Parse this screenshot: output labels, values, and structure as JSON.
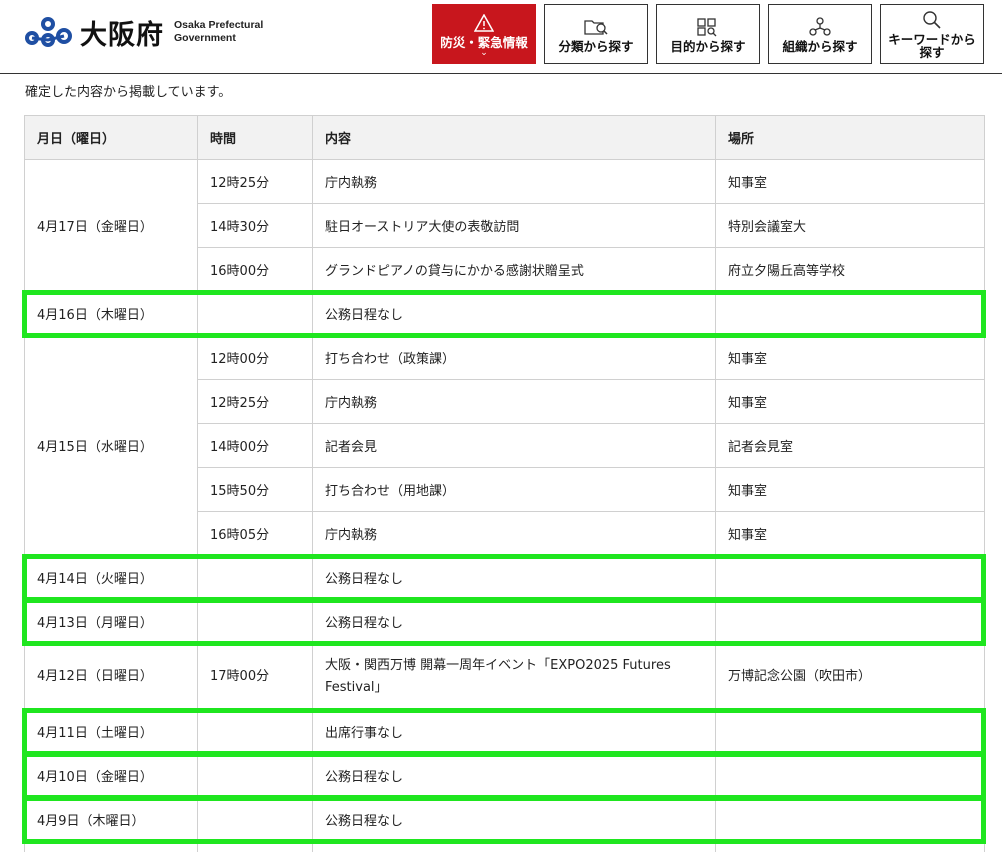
{
  "header": {
    "logo_jp": "大阪府",
    "logo_en_line1": "Osaka Prefectural",
    "logo_en_line2": "Government",
    "nav": [
      {
        "label": "防災・緊急情報",
        "icon": "warning-icon"
      },
      {
        "label": "分類から探す",
        "icon": "folder-search-icon"
      },
      {
        "label": "目的から探す",
        "icon": "grid-search-icon"
      },
      {
        "label": "組織から探す",
        "icon": "org-icon"
      },
      {
        "label": "キーワードから探す",
        "icon": "search-icon"
      }
    ],
    "emergency_color": "#c8161d"
  },
  "intro": "確定した内容から掲載しています。",
  "table": {
    "headers": [
      "月日（曜日）",
      "時間",
      "内容",
      "場所"
    ],
    "groups": [
      {
        "date": "4月17日（金曜日）",
        "rows": [
          {
            "time": "12時25分",
            "content": "庁内執務",
            "place": "知事室"
          },
          {
            "time": "14時30分",
            "content": "駐日オーストリア大使の表敬訪問",
            "place": "特別会議室大"
          },
          {
            "time": "16時00分",
            "content": "グランドピアノの貸与にかかる感謝状贈呈式",
            "place": "府立夕陽丘高等学校"
          }
        ]
      },
      {
        "date": "4月16日（木曜日）",
        "rows": [
          {
            "time": "",
            "content": "公務日程なし",
            "place": ""
          }
        ]
      },
      {
        "date": "4月15日（水曜日）",
        "rows": [
          {
            "time": "12時00分",
            "content": "打ち合わせ（政策課）",
            "place": "知事室"
          },
          {
            "time": "12時25分",
            "content": "庁内執務",
            "place": "知事室"
          },
          {
            "time": "14時00分",
            "content": "記者会見",
            "place": "記者会見室"
          },
          {
            "time": "15時50分",
            "content": "打ち合わせ（用地課）",
            "place": "知事室"
          },
          {
            "time": "16時05分",
            "content": "庁内執務",
            "place": "知事室"
          }
        ]
      },
      {
        "date": "4月14日（火曜日）",
        "rows": [
          {
            "time": "",
            "content": "公務日程なし",
            "place": ""
          }
        ]
      },
      {
        "date": "4月13日（月曜日）",
        "rows": [
          {
            "time": "",
            "content": "公務日程なし",
            "place": ""
          }
        ]
      },
      {
        "date": "4月12日（日曜日）",
        "rows": [
          {
            "time": "17時00分",
            "content": "大阪・関西万博 開幕一周年イベント「EXPO2025 Futures Festival」",
            "place": "万博記念公園（吹田市）",
            "tall": true
          }
        ]
      },
      {
        "date": "4月11日（土曜日）",
        "rows": [
          {
            "time": "",
            "content": "出席行事なし",
            "place": ""
          }
        ]
      },
      {
        "date": "4月10日（金曜日）",
        "rows": [
          {
            "time": "",
            "content": "公務日程なし",
            "place": ""
          }
        ]
      },
      {
        "date": "4月9日（木曜日）",
        "rows": [
          {
            "time": "",
            "content": "公務日程なし",
            "place": ""
          }
        ]
      },
      {
        "date": "",
        "rows": [
          {
            "time": "",
            "content": "",
            "place": ""
          }
        ]
      }
    ]
  },
  "highlight_color": "#1fe61f"
}
